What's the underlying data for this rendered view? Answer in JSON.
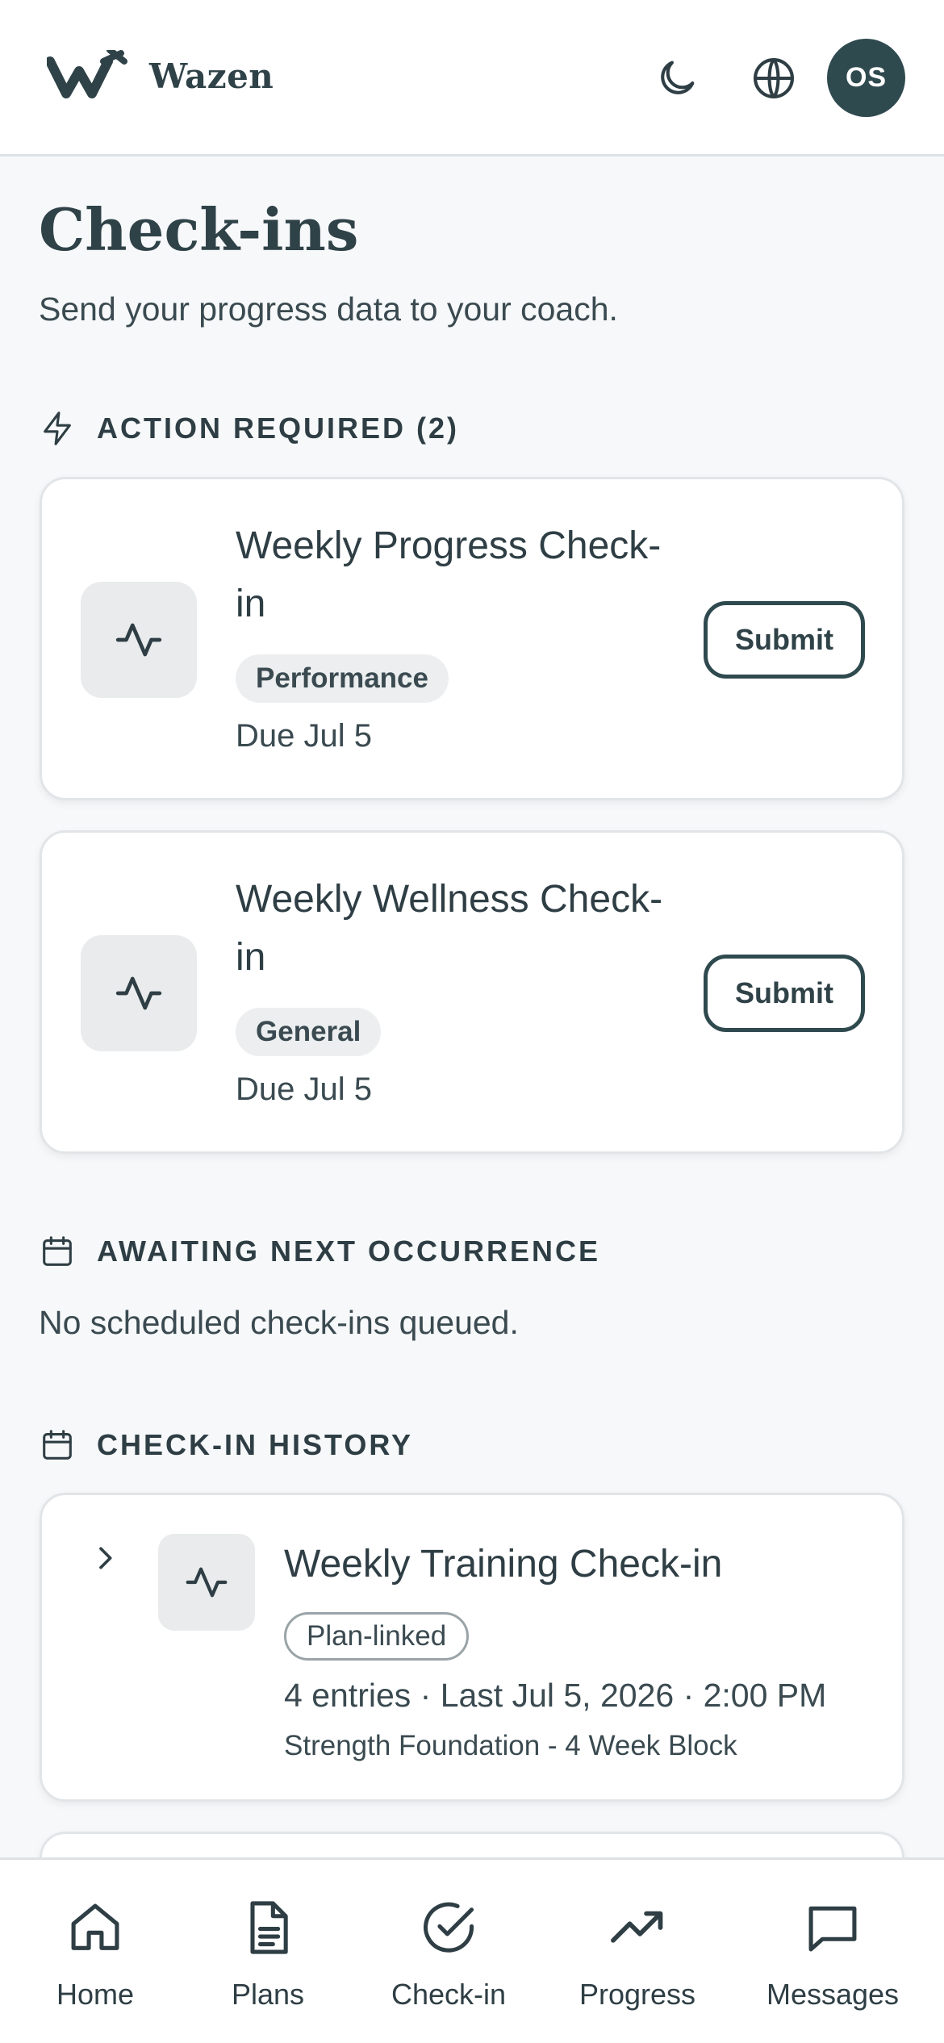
{
  "app": {
    "brand": "Wazen",
    "avatar_initials": "OS"
  },
  "header_icons": [
    "moon-icon",
    "globe-icon"
  ],
  "page": {
    "title": "Check-ins",
    "subtitle": "Send your progress data to your coach."
  },
  "sections": {
    "action_required": "ACTION REQUIRED (2)",
    "awaiting": "AWAITING NEXT OCCURRENCE",
    "awaiting_empty": "No scheduled check-ins queued.",
    "history": "CHECK-IN HISTORY"
  },
  "action_items": [
    {
      "title_line1": "Weekly Progress Check-",
      "title_line2": "in",
      "tag": "Performance",
      "due": "Due Jul 5",
      "button": "Submit"
    },
    {
      "title_line1": "Weekly Wellness Check-",
      "title_line2": "in",
      "tag": "General",
      "due": "Due Jul 5",
      "button": "Submit"
    }
  ],
  "history": [
    {
      "title": "Weekly Training Check-in",
      "tag": "Plan-linked",
      "meta": "4 entries · Last Jul 5, 2026 · 2:00 PM",
      "plan": "Strength Foundation - 4 Week Block"
    }
  ],
  "nav": [
    {
      "label": "Home",
      "icon": "home-icon"
    },
    {
      "label": "Plans",
      "icon": "document-icon"
    },
    {
      "label": "Check-in",
      "icon": "check-circle-icon"
    },
    {
      "label": "Progress",
      "icon": "trending-up-icon"
    },
    {
      "label": "Messages",
      "icon": "chat-icon"
    }
  ],
  "colors": {
    "accent": "#2f4a4f",
    "background": "#f6f8f9",
    "card": "#ffffff",
    "text": "#2e3e44"
  }
}
